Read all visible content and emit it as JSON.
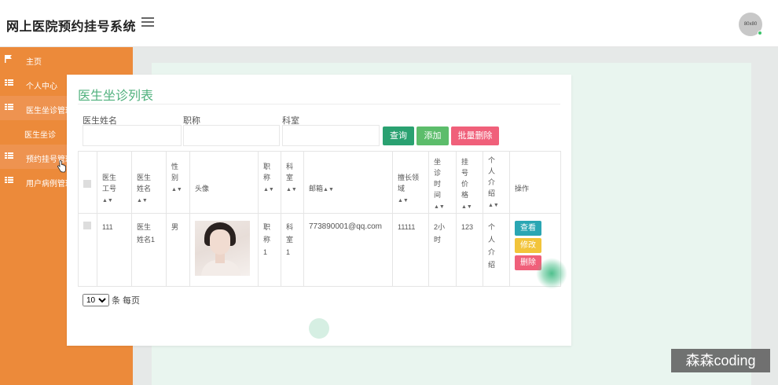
{
  "header": {
    "title": "网上医院预约挂号系统",
    "avatar_text": "80x80"
  },
  "sidebar": {
    "items": [
      {
        "label": "主页",
        "icon": "flag-icon"
      },
      {
        "label": "个人中心",
        "icon": "grid-icon"
      },
      {
        "label": "医生坐诊管理",
        "icon": "grid-icon"
      },
      {
        "label": "医生坐诊",
        "icon": ""
      },
      {
        "label": "预约挂号管理",
        "icon": "grid-icon"
      },
      {
        "label": "用户病例管理",
        "icon": "grid-icon"
      }
    ]
  },
  "page": {
    "title": "医生坐诊列表",
    "filters": {
      "doctor_name_label": "医生姓名",
      "title_label": "职称",
      "department_label": "科室"
    },
    "buttons": {
      "query": "查询",
      "add": "添加",
      "batch_delete": "批量删除"
    },
    "table": {
      "headers": [
        "",
        "医生工号",
        "医生姓名",
        "性别",
        "头像",
        "职称",
        "科室",
        "邮箱",
        "擅长领域",
        "坐诊时间",
        "挂号价格",
        "个人介绍",
        "操作"
      ],
      "rows": [
        {
          "id": "111",
          "name": "医生姓名1",
          "gender": "男",
          "title": "职称1",
          "department": "科室1",
          "email": "773890001@qq.com",
          "specialty": "11111",
          "time": "2小时",
          "price": "123",
          "intro": "个人介绍"
        }
      ],
      "actions": {
        "view": "查看",
        "edit": "修改",
        "delete": "删除"
      }
    },
    "pager": {
      "page_size": "10",
      "suffix": "条 每页"
    }
  },
  "overlay": {
    "watermark": "森森coding"
  },
  "colors": {
    "sidebar": "#ec8a3a",
    "title_green": "#4fb07c",
    "query": "#2aa171",
    "add": "#5cbd6b",
    "delete": "#f0607a",
    "view": "#2aa6b3",
    "edit": "#f2c43a"
  }
}
